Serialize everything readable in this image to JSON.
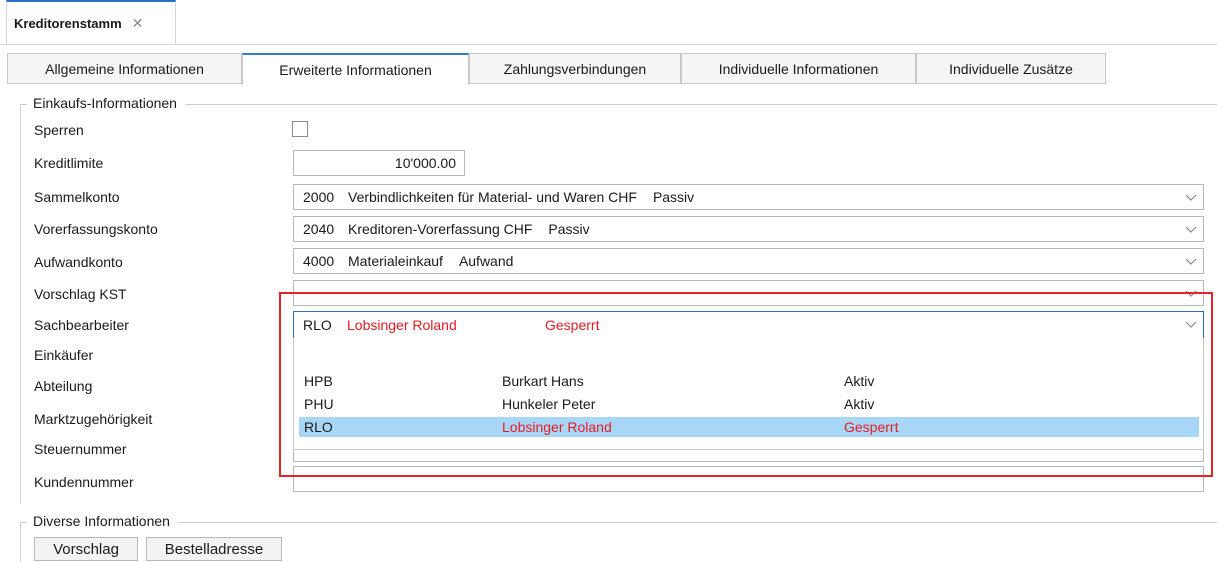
{
  "document_tab": {
    "title": "Kreditorenstamm",
    "close_glyph": "✕"
  },
  "tabs": [
    {
      "label": "Allgemeine Informationen",
      "active": false
    },
    {
      "label": "Erweiterte Informationen",
      "active": true
    },
    {
      "label": "Zahlungsverbindungen",
      "active": false
    },
    {
      "label": "Individuelle Informationen",
      "active": false
    },
    {
      "label": "Individuelle Zusätze",
      "active": false
    }
  ],
  "purchasing": {
    "legend": "Einkaufs-Informationen",
    "labels": {
      "sperren": "Sperren",
      "kreditlimite": "Kreditlimite",
      "sammelkonto": "Sammelkonto",
      "vorerfassungskonto": "Vorerfassungskonto",
      "aufwandkonto": "Aufwandkonto",
      "vorschlag_kst": "Vorschlag KST",
      "sachbearbeiter": "Sachbearbeiter",
      "einkaeufer": "Einkäufer",
      "abteilung": "Abteilung",
      "marktzugehoerigkeit": "Marktzugehörigkeit",
      "steuernummer": "Steuernummer",
      "kundennummer": "Kundennummer"
    },
    "sperren_checked": false,
    "kreditlimite_value": "10'000.00",
    "sammelkonto": {
      "code": "2000",
      "name": "Verbindlichkeiten für Material- und Waren CHF",
      "type": "Passiv"
    },
    "vorerfassungskonto": {
      "code": "2040",
      "name": "Kreditoren-Vorerfassung CHF",
      "type": "Passiv"
    },
    "aufwandkonto": {
      "code": "4000",
      "name": "Materialeinkauf",
      "type": "Aufwand"
    },
    "sachbearbeiter": {
      "code": "RLO",
      "name": "Lobsinger Roland",
      "status": "Gesperrt"
    },
    "dropdown_options": [
      {
        "code": "HPB",
        "name": "Burkart Hans",
        "status": "Aktiv",
        "selected": false
      },
      {
        "code": "PHU",
        "name": "Hunkeler Peter",
        "status": "Aktiv",
        "selected": false
      },
      {
        "code": "RLO",
        "name": "Lobsinger Roland",
        "status": "Gesperrt",
        "selected": true
      }
    ]
  },
  "diverse": {
    "legend": "Diverse Informationen",
    "buttons": {
      "vorschlag": "Vorschlag",
      "bestelladresse": "Bestelladresse"
    }
  },
  "colors": {
    "accent": "#2b6cc4",
    "blocked_text": "#e81b23",
    "selection": "#a8d6f7",
    "highlight_box": "#e3242b"
  }
}
